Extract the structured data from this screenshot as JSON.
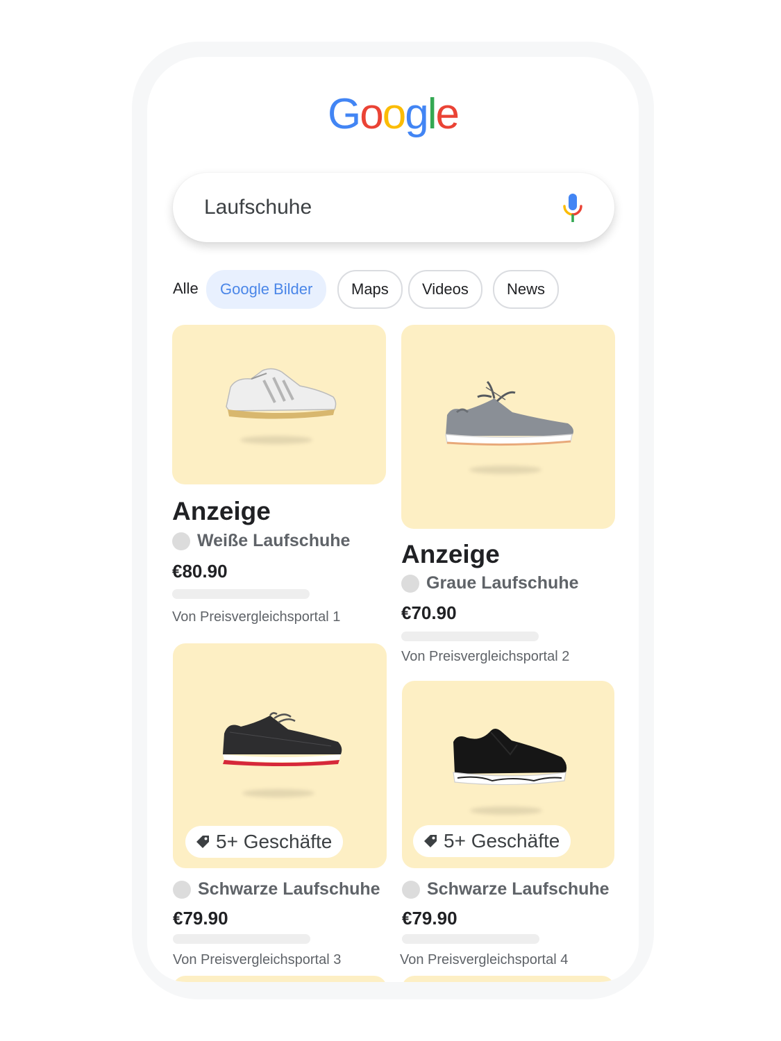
{
  "logo": {
    "letters": [
      {
        "char": "G",
        "color": "#4285F4"
      },
      {
        "char": "o",
        "color": "#EA4335"
      },
      {
        "char": "o",
        "color": "#FBBC05"
      },
      {
        "char": "g",
        "color": "#4285F4"
      },
      {
        "char": "l",
        "color": "#34A853"
      },
      {
        "char": "e",
        "color": "#EA4335"
      }
    ]
  },
  "search": {
    "query": "Laufschuhe",
    "mic_icon": "microphone-icon"
  },
  "tabs": {
    "all": "Alle",
    "images": "Google Bilder",
    "maps": "Maps",
    "videos": "Videos",
    "news": "News"
  },
  "products": [
    {
      "ad_label": "Anzeige",
      "title": "Weiße Laufschuhe",
      "price": "€80.90",
      "source": "Von Preisvergleichsportal 1",
      "shoe_color": "white"
    },
    {
      "ad_label": "Anzeige",
      "title": "Graue Laufschuhe",
      "price": "€70.90",
      "source": "Von Preisvergleichsportal 2",
      "shoe_color": "grey"
    },
    {
      "badge": "5+ Geschäfte",
      "title": "Schwarze Laufschuhe",
      "price": "€79.90",
      "source": "Von Preisvergleichsportal 3",
      "shoe_color": "black-red"
    },
    {
      "badge": "5+ Geschäfte",
      "title": "Schwarze Laufschuhe",
      "price": "€79.90",
      "source": "Von Preisvergleichsportal 4",
      "shoe_color": "black"
    }
  ],
  "colors": {
    "card_background": "#fdefc4",
    "active_chip_background": "#e8f0fe",
    "active_chip_text": "#4a86e8"
  }
}
